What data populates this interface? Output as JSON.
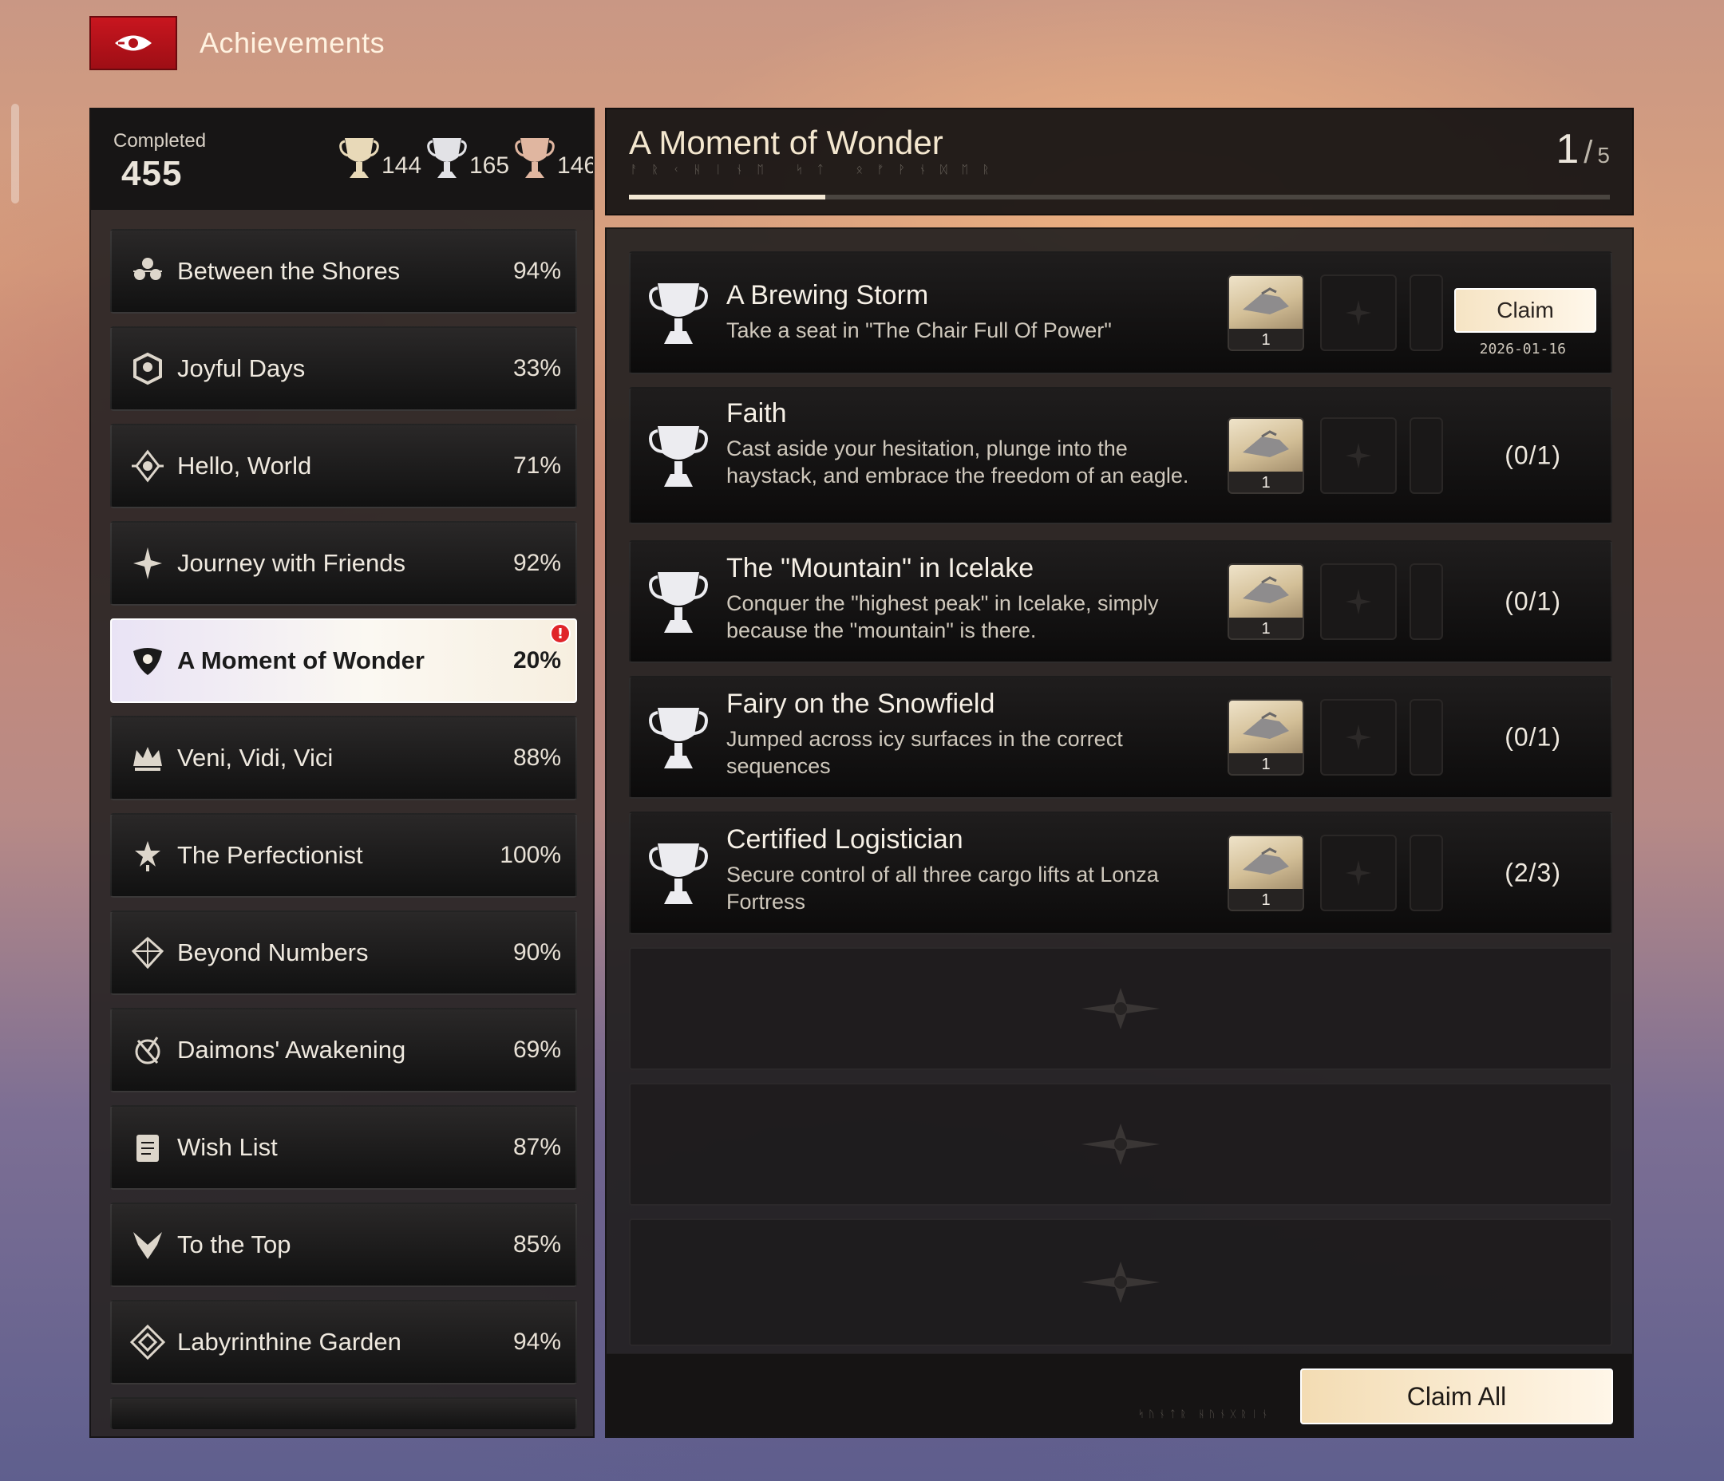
{
  "header": {
    "title": "Achievements"
  },
  "summary": {
    "completed_label": "Completed",
    "completed_count": "455",
    "trophies": [
      {
        "tier": "gold",
        "count": "144",
        "color": "#e8d9b8"
      },
      {
        "tier": "silver",
        "count": "165",
        "color": "#e2e2e6"
      },
      {
        "tier": "bronze",
        "count": "146",
        "color": "#e0b6a0"
      }
    ]
  },
  "categories": [
    {
      "label": "Between the Shores",
      "percent": "94%",
      "icon": "shores-icon"
    },
    {
      "label": "Joyful Days",
      "percent": "33%",
      "icon": "joyful-days-icon"
    },
    {
      "label": "Hello, World",
      "percent": "71%",
      "icon": "hello-world-icon"
    },
    {
      "label": "Journey with Friends",
      "percent": "92%",
      "icon": "journey-friends-icon"
    },
    {
      "label": "A Moment of Wonder",
      "percent": "20%",
      "icon": "wonder-icon",
      "active": true,
      "alert": "!"
    },
    {
      "label": "Veni, Vidi, Vici",
      "percent": "88%",
      "icon": "crown-icon"
    },
    {
      "label": "The Perfectionist",
      "percent": "100%",
      "icon": "perfectionist-icon"
    },
    {
      "label": "Beyond Numbers",
      "percent": "90%",
      "icon": "diamond-icon"
    },
    {
      "label": "Daimons' Awakening",
      "percent": "69%",
      "icon": "daimon-icon"
    },
    {
      "label": "Wish List",
      "percent": "87%",
      "icon": "wish-list-icon"
    },
    {
      "label": "To the Top",
      "percent": "85%",
      "icon": "to-the-top-icon"
    },
    {
      "label": "Labyrinthine Garden",
      "percent": "94%",
      "icon": "labyrinth-icon"
    }
  ],
  "detail": {
    "title": "A Moment of Wonder",
    "page_current": "1",
    "page_separator": "/",
    "page_total": "5",
    "progress_fraction": 0.2,
    "achievements": [
      {
        "name": "A Brewing Storm",
        "description": "Take a seat in \"The Chair Full Of Power\"",
        "reward_qty": "1",
        "status": "claimable",
        "claim_label": "Claim",
        "date": "2026-01-16"
      },
      {
        "name": "Faith",
        "description": "Cast aside your hesitation, plunge into the haystack, and embrace the freedom of an eagle.",
        "reward_qty": "1",
        "progress": "(0/1)"
      },
      {
        "name": "The \"Mountain\" in Icelake",
        "description": "Conquer the \"highest peak\" in Icelake, simply because the \"mountain\" is there.",
        "reward_qty": "1",
        "progress": "(0/1)"
      },
      {
        "name": "Fairy on the Snowfield",
        "description": "Jumped across icy surfaces in the correct sequences",
        "reward_qty": "1",
        "progress": "(0/1)"
      },
      {
        "name": "Certified Logistician",
        "description": "Secure control of all three cargo lifts at Lonza Fortress",
        "reward_qty": "1",
        "progress": "(2/3)"
      }
    ],
    "claim_all_label": "Claim All"
  }
}
